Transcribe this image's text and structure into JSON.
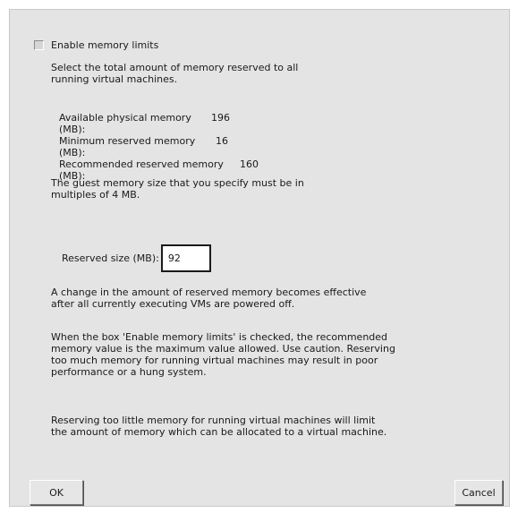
{
  "enable_checkbox": {
    "label": "Enable memory limits",
    "checked": false
  },
  "intro": "Select the total amount of memory reserved to all\nrunning virtual machines.",
  "stats": [
    {
      "label": "Available physical memory (MB):",
      "value": "196"
    },
    {
      "label": "Minimum reserved memory (MB):",
      "value": "16"
    },
    {
      "label": "Recommended reserved memory (MB):",
      "value": "160"
    }
  ],
  "multiples_note": "The guest memory size that you specify must be in\nmultiples of 4 MB.",
  "reserved": {
    "label": "Reserved size (MB):",
    "value": "92"
  },
  "effective_note": "A change in the amount of reserved memory becomes effective\nafter all currently executing VMs are powered off.",
  "caution_note": "When the box 'Enable memory limits' is checked, the recommended\nmemory value is the maximum value allowed. Use caution. Reserving\ntoo much memory for running virtual machines may result in poor\nperformance or a hung system.",
  "limit_note": "Reserving too little memory for running virtual machines will limit\nthe amount of memory which can be allocated to a virtual machine.",
  "buttons": {
    "ok": "OK",
    "cancel": "Cancel"
  }
}
